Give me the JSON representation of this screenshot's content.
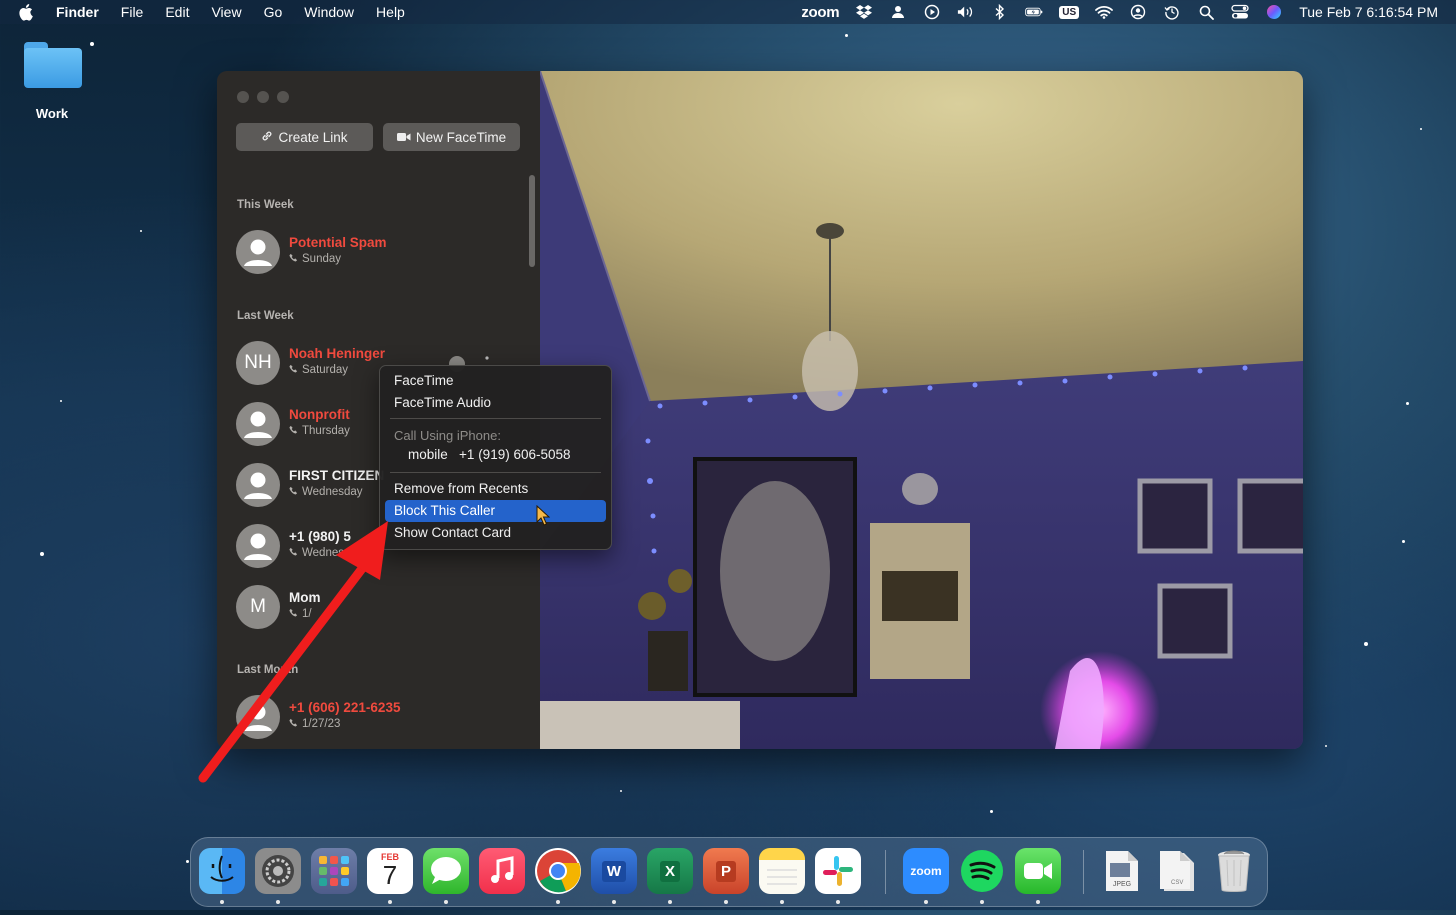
{
  "menubar": {
    "app": "Finder",
    "menus": [
      "File",
      "Edit",
      "View",
      "Go",
      "Window",
      "Help"
    ],
    "zoom": "zoom",
    "keyboard": "US",
    "clock": "Tue Feb 7  6:16:54 PM",
    "status_icons": [
      "dropbox-icon",
      "user-icon",
      "play-icon",
      "volume-icon",
      "bluetooth-icon",
      "battery-icon",
      "keyboard-icon",
      "wifi-icon",
      "account-icon",
      "time-machine-icon",
      "search-icon",
      "control-center-icon",
      "siri-icon"
    ]
  },
  "desktop": {
    "folder_label": "Work"
  },
  "sidebar": {
    "create_link": "Create Link",
    "new_facetime": "New FaceTime",
    "sections": {
      "this_week": "This Week",
      "last_week": "Last Week",
      "last_month": "Last Month"
    },
    "entries": [
      {
        "name": "Potential Spam",
        "detail": "Sunday",
        "initials": ""
      },
      {
        "name": "Noah Heninger",
        "detail": "Saturday",
        "initials": "NH"
      },
      {
        "name": "Nonprofit",
        "detail": "Thursday",
        "initials": ""
      },
      {
        "name": "FIRST CITIZEN",
        "detail": "Wednesday",
        "initials": ""
      },
      {
        "name": "+1 (980) 5",
        "detail": "Wednesday",
        "initials": ""
      },
      {
        "name": "Mom",
        "detail": "1/",
        "initials": "M"
      },
      {
        "name": "+1 (606) 221-6235",
        "detail": "1/27/23",
        "initials": ""
      }
    ]
  },
  "context_menu": {
    "facetime": "FaceTime",
    "facetime_audio": "FaceTime Audio",
    "call_using": "Call Using iPhone:",
    "mobile_label": "mobile",
    "mobile_number": "+1 (919) 606-5058",
    "remove": "Remove from Recents",
    "block": "Block This Caller",
    "show_card": "Show Contact Card"
  },
  "dock": {
    "calendar_month": "FEB",
    "calendar_day": "7",
    "zoom_label": "zoom",
    "word_letter": "W",
    "excel_letter": "X",
    "powerpoint_letter": "P",
    "jpeg_label": "JPEG",
    "csv_label": "CSV"
  },
  "colors": {
    "accent": "#2463cb",
    "missed_call": "#f04a3e",
    "annotation_arrow": "#f01d1d"
  }
}
